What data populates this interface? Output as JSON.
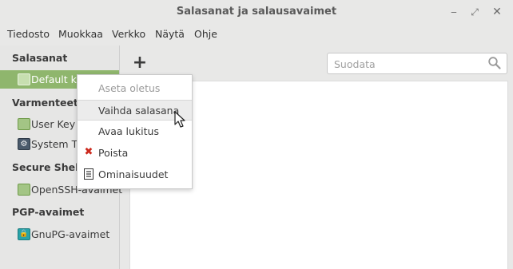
{
  "window": {
    "title": "Salasanat ja salausavaimet"
  },
  "menubar": {
    "items": [
      "Tiedosto",
      "Muokkaa",
      "Verkko",
      "Näytä",
      "Ohje"
    ]
  },
  "sidebar": {
    "sections": [
      {
        "title": "Salasanat",
        "items": [
          {
            "label": "Default keyring",
            "icon": "folder-icon",
            "selected": true
          }
        ]
      },
      {
        "title": "Varmenteet",
        "items": [
          {
            "label": "User Key Storage",
            "icon": "folder-icon"
          },
          {
            "label": "System Trust",
            "icon": "gear-icon"
          }
        ]
      },
      {
        "title": "Secure Shell",
        "items": [
          {
            "label": "OpenSSH-avaimet",
            "icon": "folder-icon"
          }
        ]
      },
      {
        "title": "PGP-avaimet",
        "items": [
          {
            "label": "GnuPG-avaimet",
            "icon": "lock-icon"
          }
        ]
      }
    ]
  },
  "toolbar": {
    "add_symbol": "+"
  },
  "search": {
    "placeholder": "Suodata",
    "value": ""
  },
  "context_menu": {
    "items": [
      {
        "label": "Aseta oletus",
        "disabled": true
      },
      {
        "label": "Vaihda salasana",
        "hovered": true
      },
      {
        "label": "Avaa lukitus"
      },
      {
        "label": "Poista",
        "icon": "delete-icon",
        "icon_color": "#cc2a1e"
      },
      {
        "label": "Ominaisuudet",
        "icon": "properties-icon"
      }
    ]
  },
  "colors": {
    "selection": "#8fb66d",
    "delete": "#cc2a1e"
  }
}
